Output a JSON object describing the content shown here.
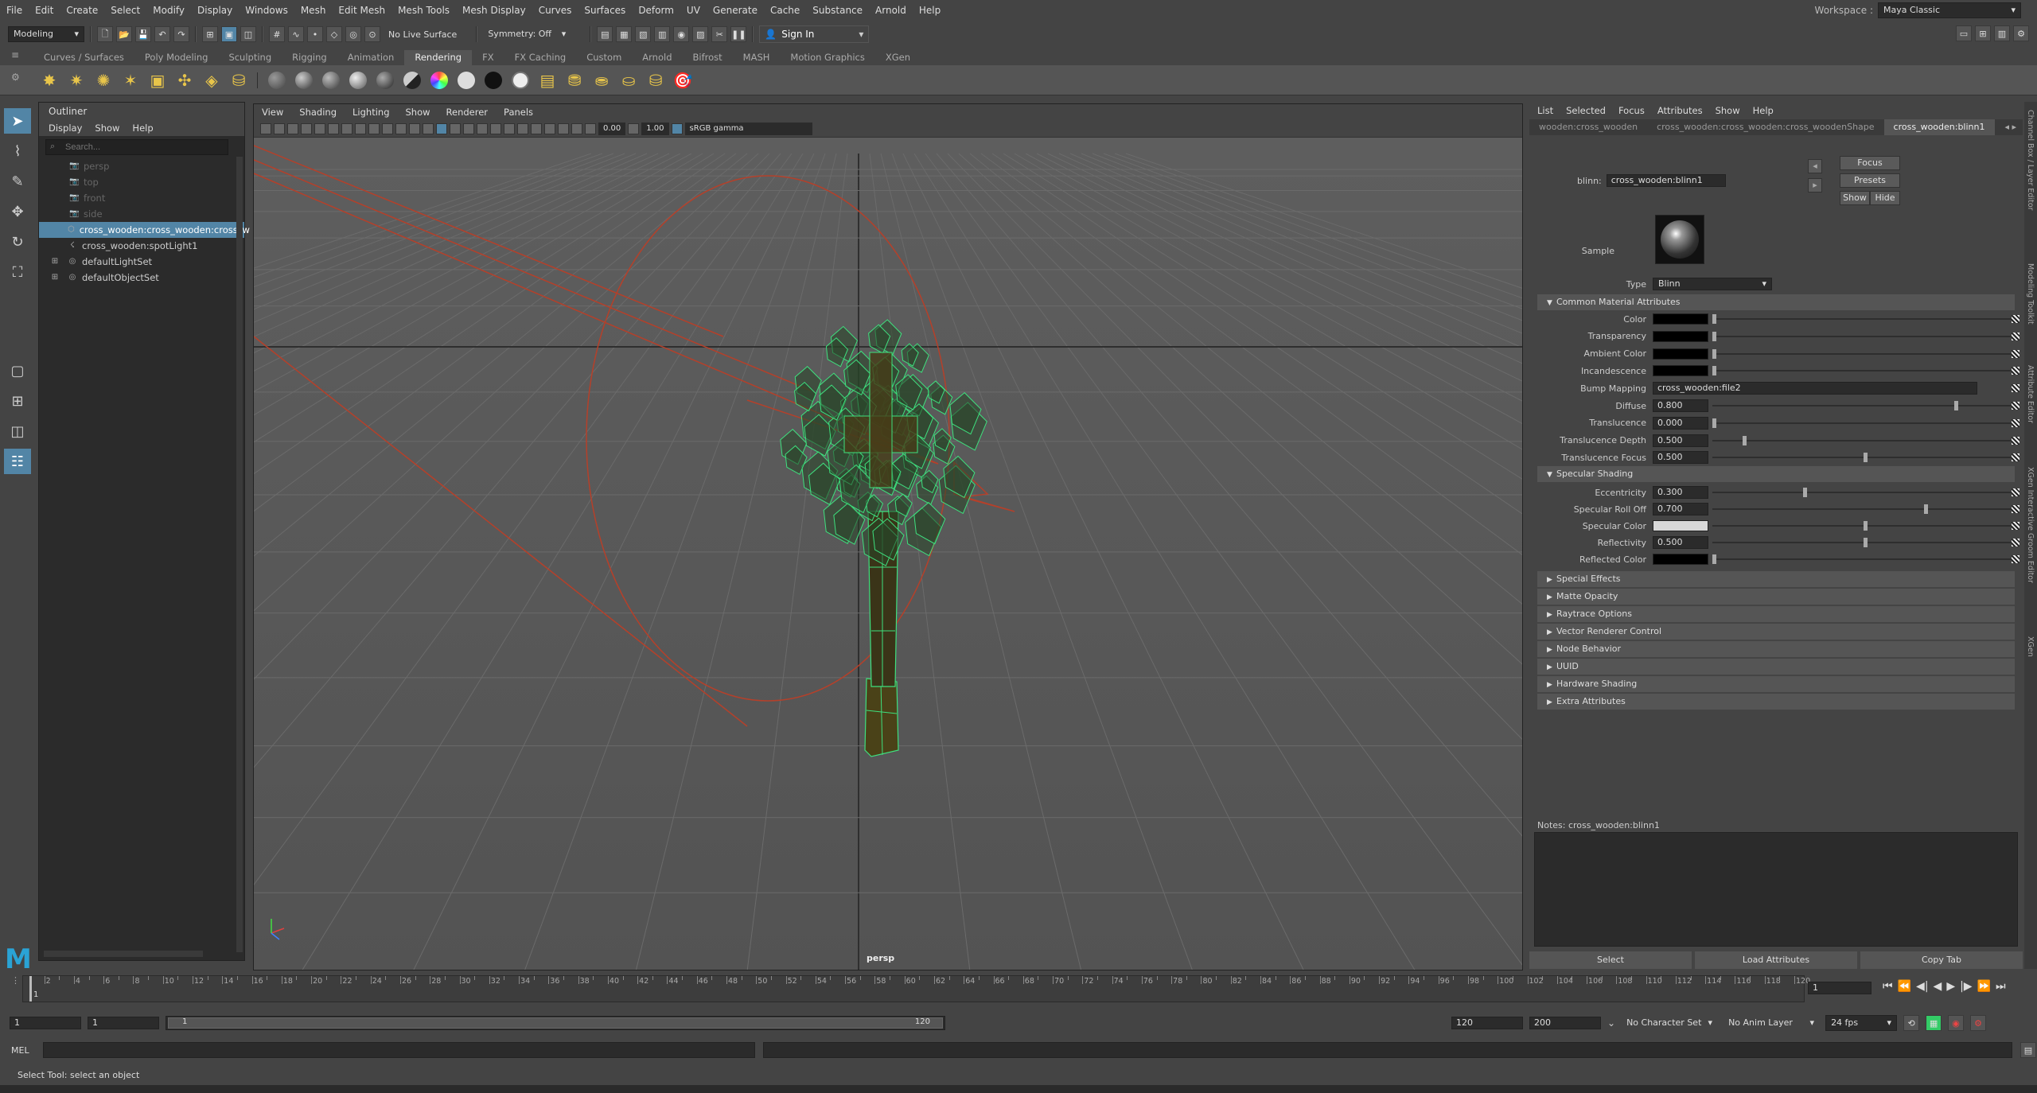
{
  "menubar": {
    "items": [
      "File",
      "Edit",
      "Create",
      "Select",
      "Modify",
      "Display",
      "Windows",
      "Mesh",
      "Edit Mesh",
      "Mesh Tools",
      "Mesh Display",
      "Curves",
      "Surfaces",
      "Deform",
      "UV",
      "Generate",
      "Cache",
      "Substance",
      "Arnold",
      "Help"
    ],
    "workspace_label": "Workspace :",
    "workspace_value": "Maya Classic"
  },
  "statusline": {
    "mode": "Modeling",
    "live_surface": "No Live Surface",
    "symmetry": "Symmetry: Off",
    "sign_in": "Sign In"
  },
  "shelf": {
    "tabs": [
      "Curves / Surfaces",
      "Poly Modeling",
      "Sculpting",
      "Rigging",
      "Animation",
      "Rendering",
      "FX",
      "FX Caching",
      "Custom",
      "Arnold",
      "Bifrost",
      "MASH",
      "Motion Graphics",
      "XGen"
    ],
    "active_tab": "Rendering"
  },
  "outliner": {
    "title": "Outliner",
    "menus": [
      "Display",
      "Show",
      "Help"
    ],
    "search_placeholder": "Search...",
    "items": [
      {
        "label": "persp",
        "icon": "camera-icon"
      },
      {
        "label": "top",
        "icon": "camera-icon"
      },
      {
        "label": "front",
        "icon": "camera-icon"
      },
      {
        "label": "side",
        "icon": "camera-icon"
      },
      {
        "label": "cross_wooden:cross_wooden:cross_w",
        "icon": "mesh-icon"
      },
      {
        "label": "cross_wooden:spotLight1",
        "icon": "spotlight-icon"
      },
      {
        "label": "defaultLightSet",
        "icon": "set-icon"
      },
      {
        "label": "defaultObjectSet",
        "icon": "set-icon"
      }
    ]
  },
  "viewport": {
    "menus": [
      "View",
      "Shading",
      "Lighting",
      "Show",
      "Renderer",
      "Panels"
    ],
    "exposure": "0.00",
    "gamma": "1.00",
    "color_space": "sRGB gamma",
    "camera_label": "persp"
  },
  "attribute_editor": {
    "menus": [
      "List",
      "Selected",
      "Focus",
      "Attributes",
      "Show",
      "Help"
    ],
    "tabs": [
      "wooden:cross_wooden",
      "cross_wooden:cross_wooden:cross_woodenShape",
      "cross_wooden:blinn1"
    ],
    "node_type_label": "blinn:",
    "node_name": "cross_wooden:blinn1",
    "focus_btn": "Focus",
    "presets_btn": "Presets",
    "show_btn": "Show",
    "hide_btn": "Hide",
    "sample_label": "Sample",
    "type_label": "Type",
    "type_value": "Blinn",
    "common_section": "Common Material Attributes",
    "common": [
      {
        "label": "Color",
        "kind": "color",
        "color": "#000000",
        "value": "",
        "level": 0.0
      },
      {
        "label": "Transparency",
        "kind": "color",
        "color": "#000000",
        "value": "",
        "level": 0.0
      },
      {
        "label": "Ambient Color",
        "kind": "color",
        "color": "#000000",
        "value": "",
        "level": 0.0
      },
      {
        "label": "Incandescence",
        "kind": "color",
        "color": "#000000",
        "value": "",
        "level": 0.0
      },
      {
        "label": "Bump Mapping",
        "kind": "text",
        "color": "",
        "value": "cross_wooden:file2",
        "level": 0.0
      },
      {
        "label": "Diffuse",
        "kind": "num",
        "color": "",
        "value": "0.800",
        "level": 0.8
      },
      {
        "label": "Translucence",
        "kind": "num",
        "color": "",
        "value": "0.000",
        "level": 0.0
      },
      {
        "label": "Translucence Depth",
        "kind": "num",
        "color": "",
        "value": "0.500",
        "level": 0.1
      },
      {
        "label": "Translucence Focus",
        "kind": "num",
        "color": "",
        "value": "0.500",
        "level": 0.5
      }
    ],
    "specular_section": "Specular Shading",
    "specular": [
      {
        "label": "Eccentricity",
        "kind": "num",
        "color": "",
        "value": "0.300",
        "level": 0.3
      },
      {
        "label": "Specular Roll Off",
        "kind": "num",
        "color": "",
        "value": "0.700",
        "level": 0.7
      },
      {
        "label": "Specular Color",
        "kind": "color",
        "color": "#d8d8d8",
        "value": "",
        "level": 0.5
      },
      {
        "label": "Reflectivity",
        "kind": "num",
        "color": "",
        "value": "0.500",
        "level": 0.5
      },
      {
        "label": "Reflected Color",
        "kind": "color",
        "color": "#000000",
        "value": "",
        "level": 0.0
      }
    ],
    "collapsed_sections": [
      "Special Effects",
      "Matte Opacity",
      "Raytrace Options",
      "Vector Renderer Control",
      "Node Behavior",
      "UUID",
      "Hardware Shading",
      "Extra Attributes"
    ],
    "notes_label": "Notes:  cross_wooden:blinn1",
    "bottom_buttons": [
      "Select",
      "Load Attributes",
      "Copy Tab"
    ]
  },
  "right_strip_labels": [
    "Channel Box / Layer Editor",
    "Modeling Toolkit",
    "Attribute Editor",
    "XGen Interactive Groom Editor",
    "XGen"
  ],
  "timeline": {
    "ticks": [
      "2",
      "4",
      "6",
      "8",
      "10",
      "12",
      "14",
      "16",
      "18",
      "20",
      "22",
      "24",
      "26",
      "28",
      "30",
      "32",
      "34",
      "36",
      "38",
      "40",
      "42",
      "44",
      "46",
      "48",
      "50",
      "52",
      "54",
      "56",
      "58",
      "60",
      "62",
      "64",
      "66",
      "68",
      "70",
      "72",
      "74",
      "76",
      "78",
      "80",
      "82",
      "84",
      "86",
      "88",
      "90",
      "92",
      "94",
      "96",
      "98",
      "100",
      "102",
      "104",
      "106",
      "108",
      "110",
      "112",
      "114",
      "116",
      "118",
      "120"
    ],
    "current_frame_marker": "1",
    "current_frame_field": "1"
  },
  "range": {
    "start": "1",
    "anim_start": "1",
    "range_start": "1",
    "range_end": "120",
    "anim_end": "120",
    "end": "200",
    "character_set": "No Character Set",
    "anim_layer": "No Anim Layer",
    "fps": "24 fps"
  },
  "cmdline": {
    "label": "MEL"
  },
  "helpline": {
    "text": "Select Tool: select an object"
  }
}
